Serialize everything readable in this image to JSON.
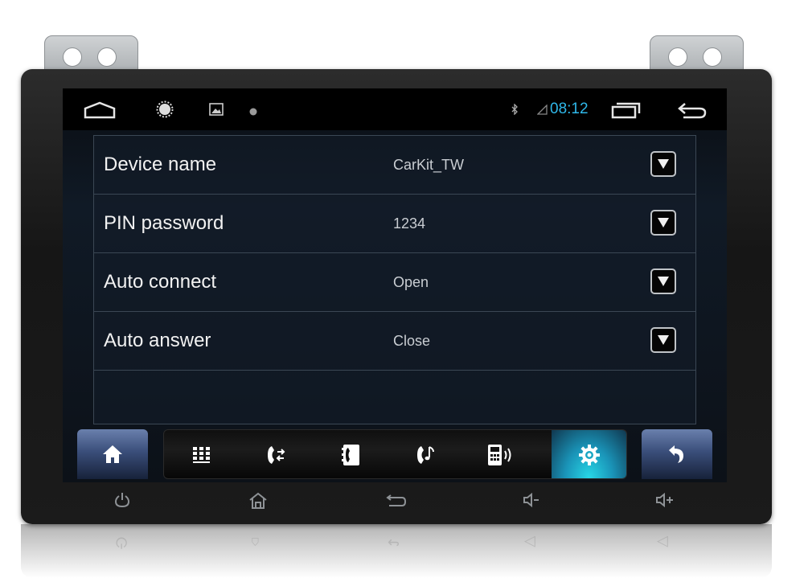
{
  "statusbar": {
    "time": "08:12",
    "icons": [
      "home-outline-icon",
      "brightness-icon",
      "image-icon",
      "dot-icon",
      "bluetooth-icon",
      "signal-icon",
      "recent-apps-icon",
      "back-arrow-icon"
    ]
  },
  "settings": {
    "rows": [
      {
        "label": "Device name",
        "value": "CarKit_TW"
      },
      {
        "label": "PIN password",
        "value": "1234"
      },
      {
        "label": "Auto connect",
        "value": "Open"
      },
      {
        "label": "Auto answer",
        "value": "Close"
      }
    ]
  },
  "toolbar": {
    "items": [
      "home-icon",
      "dialpad-icon",
      "call-transfer-icon",
      "contacts-icon",
      "call-music-icon",
      "phone-speaker-icon",
      "settings-gear-icon",
      "return-icon"
    ],
    "active": "settings-gear-icon",
    "accent_color": "#27d7e6"
  },
  "hardware_buttons": [
    "power-icon",
    "home-house-icon",
    "back-icon",
    "volume-down-icon",
    "volume-up-icon"
  ]
}
